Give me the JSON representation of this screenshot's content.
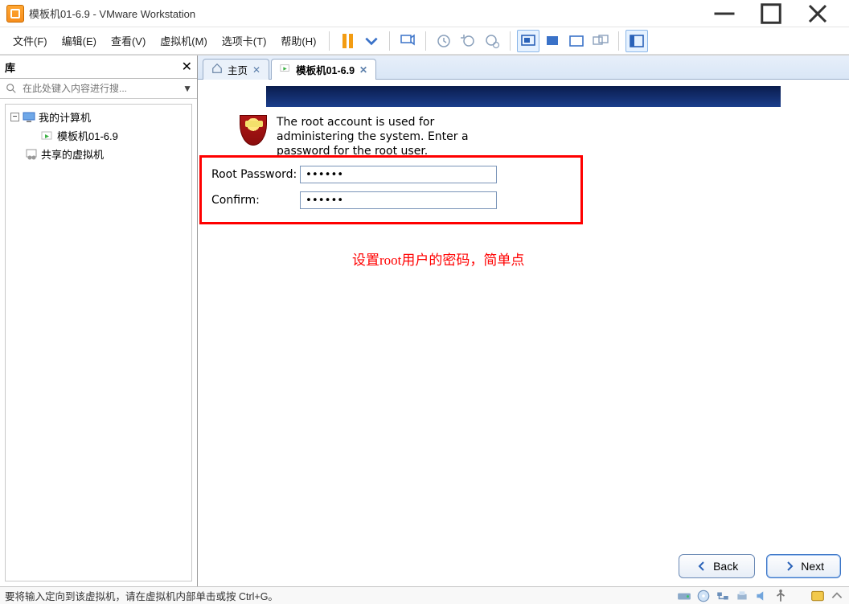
{
  "window": {
    "title": "模板机01-6.9 - VMware Workstation"
  },
  "menu": {
    "file": "文件(F)",
    "edit": "编辑(E)",
    "view": "查看(V)",
    "vm": "虚拟机(M)",
    "tabs": "选项卡(T)",
    "help": "帮助(H)"
  },
  "sidebar": {
    "title": "库",
    "search_placeholder": "在此处键入内容进行搜...",
    "tree": {
      "root": "我的计算机",
      "items": [
        "模板机01-6.9"
      ],
      "shared": "共享的虚拟机"
    }
  },
  "tabs": [
    {
      "label": "主页",
      "active": false
    },
    {
      "label": "模板机01-6.9",
      "active": true
    }
  ],
  "guest": {
    "description": "The root account is used for administering the system.  Enter a password for the root user.",
    "root_password_label": "Root Password:",
    "confirm_label": "Confirm:",
    "root_password_value": "••••••",
    "confirm_value": "••••••",
    "annotation": "设置root用户的密码，简单点",
    "back_label": "Back",
    "next_label": "Next"
  },
  "statusbar": {
    "text": "要将输入定向到该虚拟机，请在虚拟机内部单击或按 Ctrl+G。"
  }
}
